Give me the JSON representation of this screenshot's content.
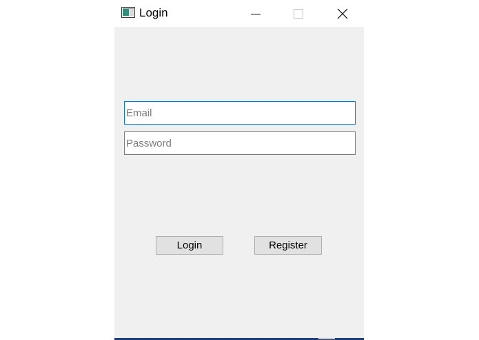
{
  "window": {
    "title": "Login",
    "title_icon": "app-window-icon",
    "controls": {
      "minimize_icon": "minimize-icon",
      "maximize_icon": "maximize-icon",
      "close_icon": "close-icon"
    }
  },
  "form": {
    "email_placeholder": "Email",
    "email_value": "",
    "password_placeholder": "Password",
    "password_value": ""
  },
  "buttons": {
    "login_label": "Login",
    "register_label": "Register"
  },
  "colors": {
    "client_background": "#f0f0f0",
    "focus_border": "#0078d7",
    "button_background": "#e1e1e1",
    "taskbar_edge": "#1e3f7a"
  }
}
